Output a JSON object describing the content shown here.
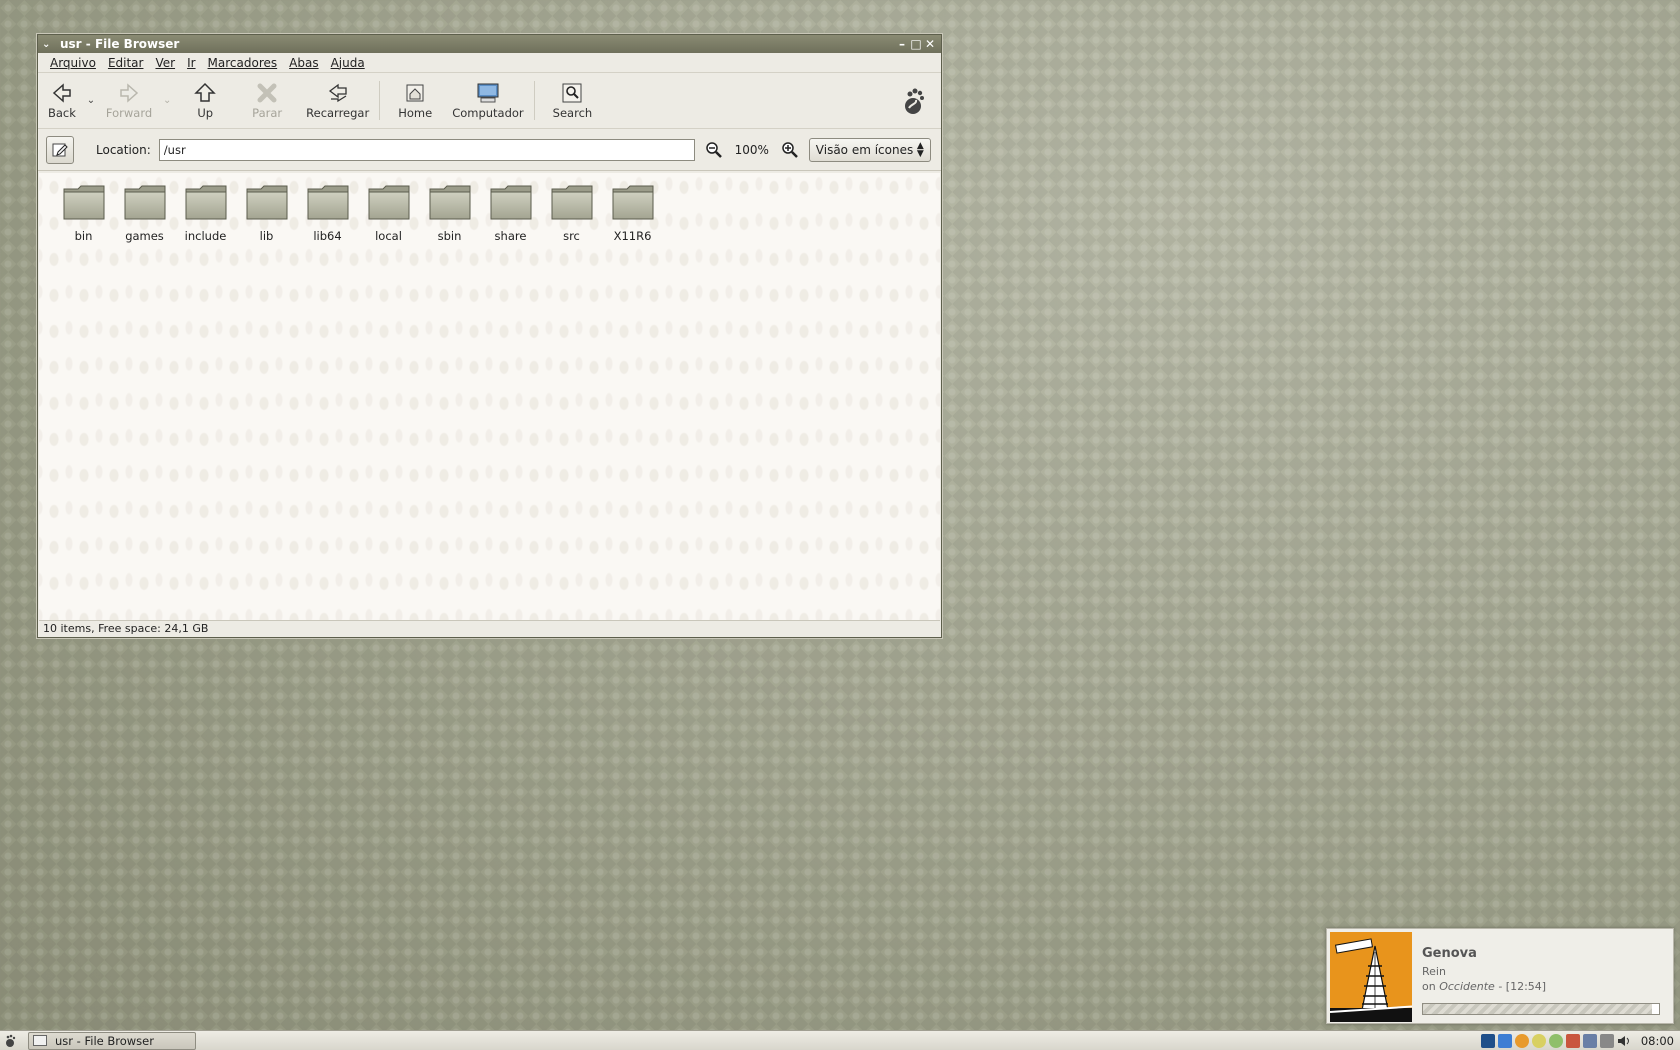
{
  "window": {
    "title": "usr - File Browser",
    "menu": [
      "Arquivo",
      "Editar",
      "Ver",
      "Ir",
      "Marcadores",
      "Abas",
      "Ajuda"
    ],
    "toolbar": {
      "back": "Back",
      "forward": "Forward",
      "up": "Up",
      "stop": "Parar",
      "reload": "Recarregar",
      "home": "Home",
      "computer": "Computador",
      "search": "Search"
    },
    "location": {
      "label": "Location:",
      "value": "/usr",
      "zoom": "100%",
      "view_mode": "Visão em ícones"
    },
    "items": [
      "bin",
      "games",
      "include",
      "lib",
      "lib64",
      "local",
      "sbin",
      "share",
      "src",
      "X11R6"
    ],
    "status": "10 items, Free space: 24,1 GB"
  },
  "notification": {
    "song": "Genova",
    "artist": "Rein",
    "album_prefix": "on ",
    "album": "Occidente",
    "duration": " - [12:54]",
    "progress": 0.97
  },
  "taskbar": {
    "task": "usr - File Browser",
    "clock": "08:00"
  },
  "colors": {
    "titlebar": "#7d7e67",
    "desktop": "#a8ab97",
    "cover": "#e8941c"
  }
}
